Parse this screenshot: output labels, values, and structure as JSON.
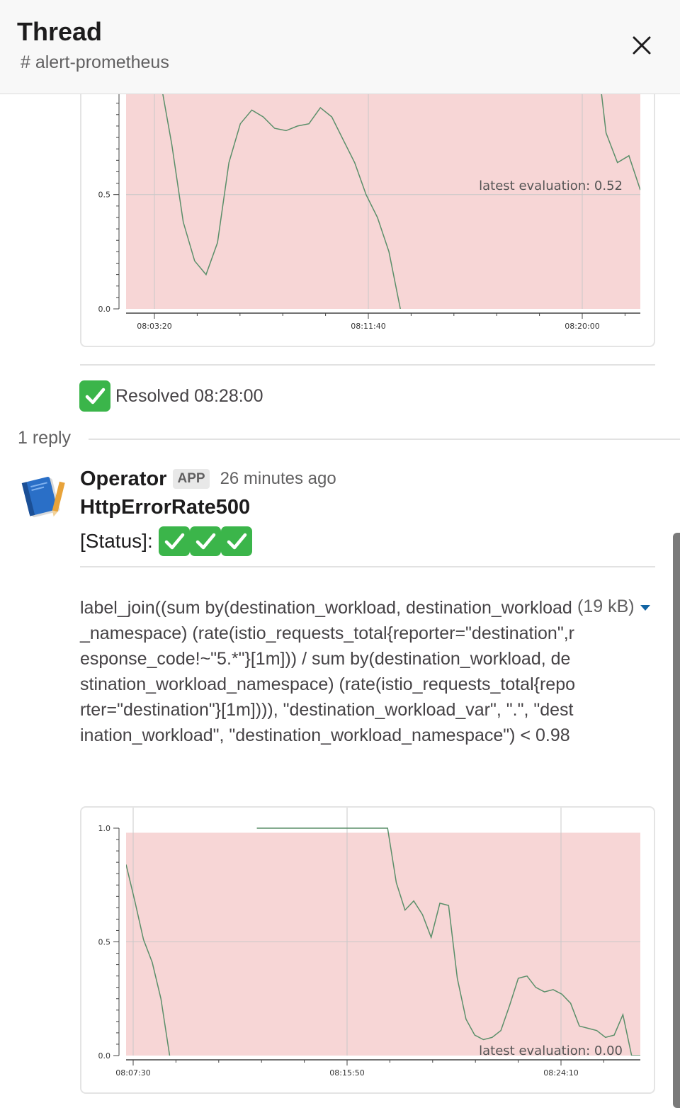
{
  "header": {
    "title": "Thread",
    "channel": "# alert-prometheus"
  },
  "parent_message": {
    "resolved_text": "Resolved 08:28:00"
  },
  "thread": {
    "reply_count": "1 reply"
  },
  "reply": {
    "author": "Operator",
    "badge": "APP",
    "time": "26 minutes ago",
    "title": "HttpErrorRate500",
    "status_label": "[Status]:",
    "expression": "label_join((sum by(destination_workload, destination_workload_namespace) (rate(istio_requests_total{reporter=\"destination\",response_code!~\"5.*\"}[1m])) / sum by(destination_workload, destination_workload_namespace) (rate(istio_requests_total{reporter=\"destination\"}[1m]))), \"destination_workload_var\", \".\", \"destination_workload\", \"destination_workload_namespace\") < 0.98",
    "file_size": "(19 kB)"
  },
  "chart_data": [
    {
      "type": "line",
      "annotation": "latest evaluation: 0.52",
      "yticks": [
        "0.0",
        "0.5"
      ],
      "xticks": [
        "08:03:20",
        "08:11:40",
        "08:20:00"
      ],
      "ylim": [
        0,
        1.0
      ],
      "grid": true,
      "x": [
        "08:01:00",
        "08:02:00",
        "08:03:00",
        "08:03:40",
        "08:04:00",
        "08:04:30",
        "08:05:00",
        "08:05:30",
        "08:05:50",
        "08:06:10",
        "08:06:30",
        "08:07:00",
        "08:07:20",
        "08:07:40",
        "08:08:10",
        "08:08:30",
        "08:08:50",
        "08:09:10",
        "08:09:30",
        "08:09:50",
        "08:10:10",
        "08:10:30",
        "08:10:50",
        "08:11:10",
        "08:11:30",
        "08:11:50",
        "08:12:10",
        "08:12:40",
        "08:13:10",
        "08:13:40",
        "08:14:10",
        "08:14:40",
        "08:15:10",
        "08:15:40",
        "08:16:10",
        "08:16:40",
        "08:17:10",
        "08:17:40",
        "08:18:10",
        "08:18:40",
        "08:19:10",
        "08:19:40",
        "08:20:10",
        "08:20:40",
        "08:21:10"
      ],
      "series": [
        {
          "values": [
            null,
            null,
            1.15,
            1.0,
            0.72,
            0.38,
            0.21,
            0.15,
            0.29,
            0.64,
            0.81,
            0.87,
            0.84,
            0.79,
            0.78,
            0.8,
            0.81,
            0.88,
            0.84,
            0.74,
            0.64,
            0.5,
            0.4,
            0.25,
            0.0,
            null,
            null,
            null,
            null,
            null,
            null,
            null,
            null,
            null,
            null,
            null,
            null,
            null,
            null,
            null,
            null,
            1.2,
            0.77,
            0.64,
            0.67,
            0.52
          ]
        }
      ],
      "band": {
        "color": "#f7d6d6",
        "from": 0.0,
        "to": 1.0
      }
    },
    {
      "type": "line",
      "annotation": "latest evaluation: 0.00",
      "yticks": [
        "0.0",
        "0.5",
        "1.0"
      ],
      "xticks": [
        "08:07:30",
        "08:15:50",
        "08:24:10"
      ],
      "ylim": [
        0,
        1.0
      ],
      "grid": true,
      "series": [
        {
          "values": [
            0.84,
            0.68,
            0.51,
            0.41,
            0.25,
            0.0,
            null,
            null,
            null,
            null,
            null,
            null,
            null,
            null,
            null,
            1.0,
            1.0,
            1.0,
            1.0,
            1.0,
            1.0,
            1.0,
            1.0,
            1.0,
            1.0,
            1.0,
            1.0,
            1.0,
            1.0,
            1.0,
            1.0,
            0.76,
            0.64,
            0.68,
            0.62,
            0.52,
            0.67,
            0.66,
            0.34,
            0.16,
            0.09,
            0.07,
            0.08,
            0.11,
            0.22,
            0.34,
            0.35,
            0.3,
            0.28,
            0.29,
            0.27,
            0.23,
            0.13,
            0.12,
            0.11,
            0.08,
            0.09,
            0.18,
            0.0,
            0.0
          ]
        }
      ],
      "band": {
        "color": "#f7d6d6",
        "from": 0.0,
        "to": 0.98
      }
    }
  ],
  "colors": {
    "line": "#5b8f6a",
    "band": "#f7d6d6",
    "check_green": "#3bb54a",
    "caret_blue": "#1264a3"
  },
  "icons": {
    "close": "close-icon",
    "check": "check-mark-icon",
    "avatar": "book-icon",
    "caret": "caret-down-icon"
  }
}
